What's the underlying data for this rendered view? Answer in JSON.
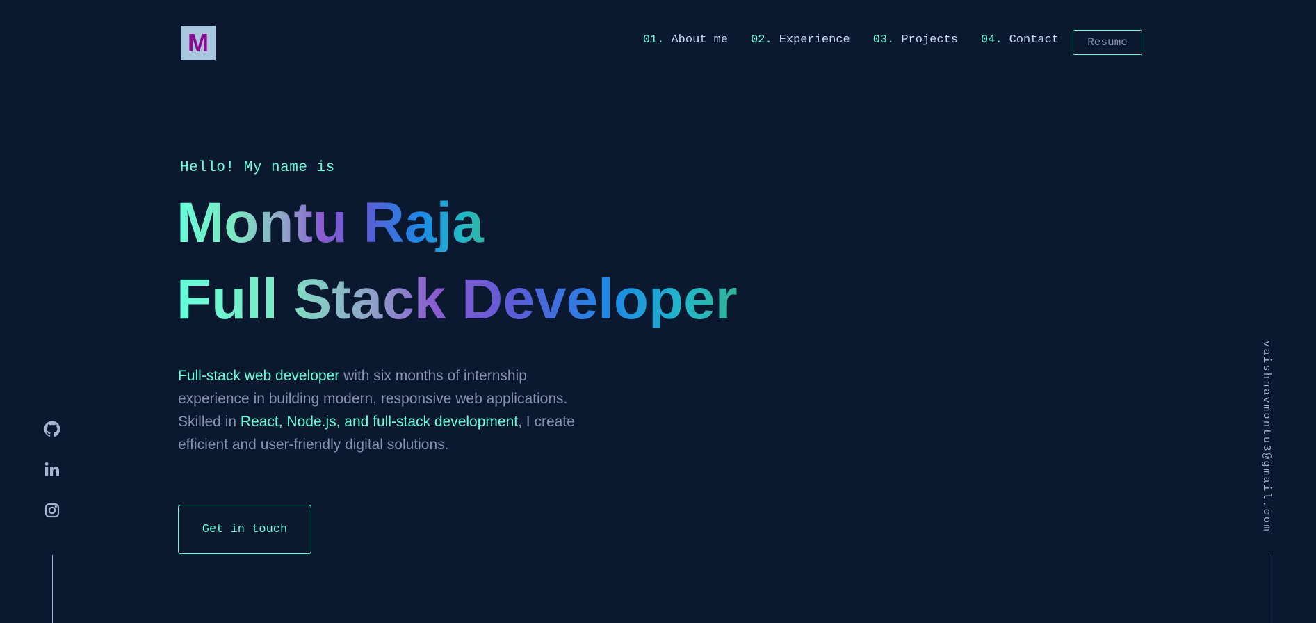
{
  "header": {
    "logo_letter": "M",
    "nav": [
      {
        "num": "01.",
        "label": "About me"
      },
      {
        "num": "02.",
        "label": "Experience"
      },
      {
        "num": "03.",
        "label": "Projects"
      },
      {
        "num": "04.",
        "label": "Contact"
      }
    ],
    "resume_label": "Resume"
  },
  "hero": {
    "greeting": "Hello! My name is",
    "name": "Montu Raja",
    "title": "Full Stack Developer",
    "bio": {
      "part1": "Full-stack web developer",
      "part2": " with six months of internship experience in building modern, responsive web applications. Skilled in ",
      "part3": "React, Node.js, and full-stack development",
      "part4": ", I create efficient and user-friendly digital solutions."
    },
    "cta_label": "Get in touch"
  },
  "social": {
    "icons": [
      "github-icon",
      "linkedin-icon",
      "instagram-icon"
    ]
  },
  "email": "vaishnavmontu3@gmail.com",
  "colors": {
    "background": "#0a192f",
    "accent": "#64ffda",
    "text_muted": "#8892b0",
    "text_light": "#ccd6f6"
  }
}
